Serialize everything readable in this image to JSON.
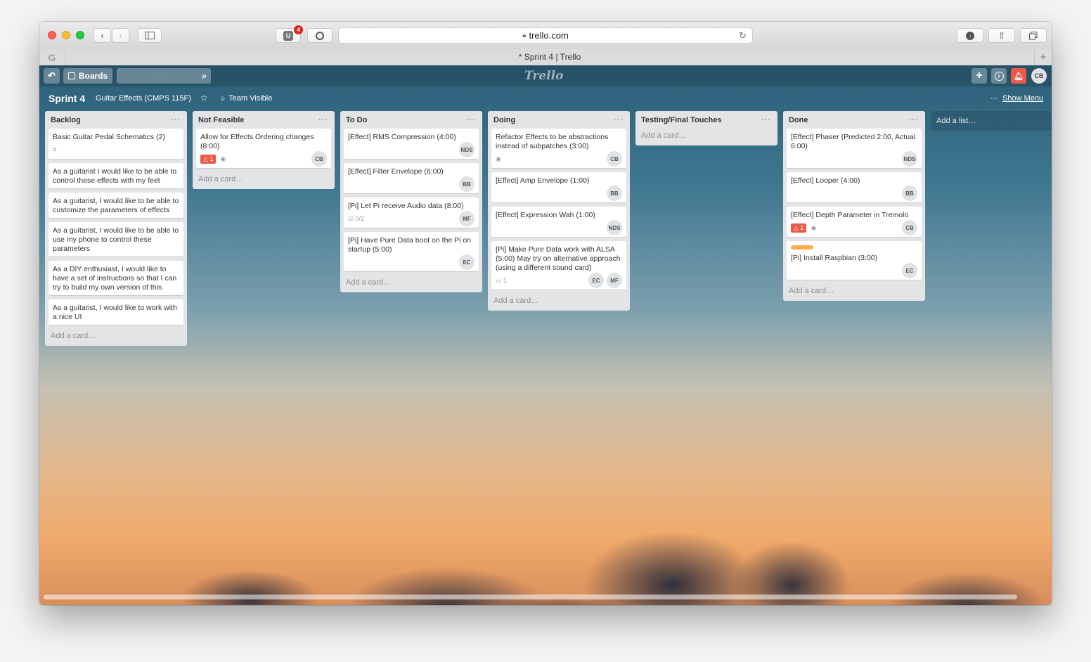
{
  "browser": {
    "address": "trello.com",
    "tab_title": "* Sprint 4 | Trello",
    "ublock_count": "4"
  },
  "header": {
    "boards_label": "Boards",
    "logo": "Trello",
    "avatar": "CB"
  },
  "board": {
    "name": "Sprint 4",
    "team": "Guitar Effects (CMPS 115F)",
    "visibility": "Team Visible",
    "show_menu": "Show Menu",
    "add_list": "Add a list…"
  },
  "add_card": "Add a card…",
  "lists": [
    {
      "title": "Backlog",
      "cards": [
        {
          "text": "Basic Guitar Pedal Schematics (2)",
          "desc_icon": true
        },
        {
          "text": "As a guitarist I would like to be able to control these effects with my feet"
        },
        {
          "text": "As a guitarist, I would like to be able to customize the parameters of effects"
        },
        {
          "text": "As a guitarist, I would like to be able to use my phone to control these parameters"
        },
        {
          "text": "As a DIY enthusiast, I would like to have a set of instructions so that I can try to build my own version of this"
        },
        {
          "text": "As a guitarist, I would like to work with a nice UI"
        }
      ]
    },
    {
      "title": "Not Feasible",
      "cards": [
        {
          "text": "Allow for Effects Ordering changes (8:00)",
          "due": "1",
          "watch": true,
          "members": [
            "CB"
          ]
        }
      ]
    },
    {
      "title": "To Do",
      "cards": [
        {
          "text": "[Effect] RMS Compression (4:00)",
          "members": [
            "NDS"
          ]
        },
        {
          "text": "[Effect] Filter Envelope (6:00)",
          "members": [
            "BB"
          ]
        },
        {
          "text": "[Pi] Let Pi receive Audio data (8:00)",
          "checklist": "0/2",
          "members": [
            "MF"
          ]
        },
        {
          "text": "[Pi] Have Pure Data boot on the Pi on startup (5:00)",
          "members": [
            "EC"
          ]
        }
      ]
    },
    {
      "title": "Doing",
      "cards": [
        {
          "text": "Refactor Effects to be abstractions instead of subpatches (3:00)",
          "watch": true,
          "members": [
            "CB"
          ]
        },
        {
          "text": "[Effect] Amp Envelope (1:00)",
          "members": [
            "BB"
          ]
        },
        {
          "text": "[Effect] Expression Wah (1:00)",
          "members": [
            "NDS"
          ]
        },
        {
          "text": "[Pi] Make Pure Data work with ALSA (5:00) May try on alternative approach (using a different sound card)",
          "comments": "1",
          "members": [
            "EC",
            "MF"
          ]
        }
      ]
    },
    {
      "title": "Testing/Final Touches",
      "cards": []
    },
    {
      "title": "Done",
      "cards": [
        {
          "text": "[Effect] Phaser (Predicted 2:00, Actual 6:00)",
          "members": [
            "NDS"
          ]
        },
        {
          "text": "[Effect] Looper (4:00)",
          "members": [
            "BB"
          ]
        },
        {
          "text": "[Effect] Depth Parameter in Tremolo",
          "due": "1",
          "watch": true,
          "members": [
            "CB"
          ]
        },
        {
          "text": "[Pi] Install Raspbian (3:00)",
          "label_color": "#ffab4a",
          "members": [
            "EC"
          ]
        }
      ]
    }
  ],
  "colors": {
    "notification_red": "#eb5a46",
    "label_orange": "#ffab4a"
  }
}
